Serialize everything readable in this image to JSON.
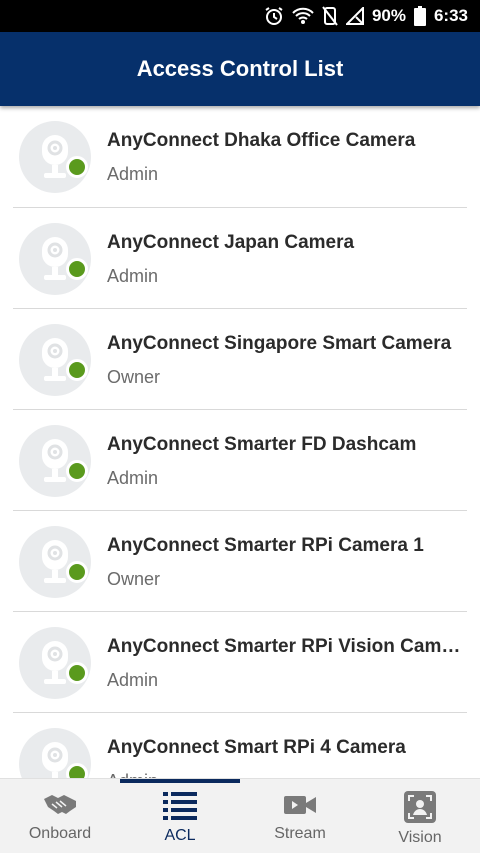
{
  "status_bar": {
    "battery_percent": "90%",
    "time": "6:33"
  },
  "app_bar": {
    "title": "Access Control List"
  },
  "devices": [
    {
      "name": "AnyConnect Dhaka Office Camera",
      "role": "Admin",
      "online": true
    },
    {
      "name": "AnyConnect Japan Camera",
      "role": "Admin",
      "online": true
    },
    {
      "name": "AnyConnect Singapore Smart Camera",
      "role": "Owner",
      "online": true
    },
    {
      "name": "AnyConnect Smarter FD Dashcam",
      "role": "Admin",
      "online": true
    },
    {
      "name": "AnyConnect Smarter RPi Camera 1",
      "role": "Owner",
      "online": true
    },
    {
      "name": "AnyConnect Smarter RPi Vision Camera",
      "role": "Admin",
      "online": true
    },
    {
      "name": "AnyConnect Smart RPi 4 Camera",
      "role": "Admin",
      "online": true
    }
  ],
  "bottom_nav": {
    "items": [
      {
        "label": "Onboard",
        "icon": "handshake-icon",
        "active": false
      },
      {
        "label": "ACL",
        "icon": "list-icon",
        "active": true
      },
      {
        "label": "Stream",
        "icon": "video-camera-icon",
        "active": false
      },
      {
        "label": "Vision",
        "icon": "face-scan-icon",
        "active": false
      }
    ]
  },
  "colors": {
    "app_bar": "#06306b",
    "online_dot": "#5a9a1d",
    "nav_active": "#0b2a5e"
  }
}
